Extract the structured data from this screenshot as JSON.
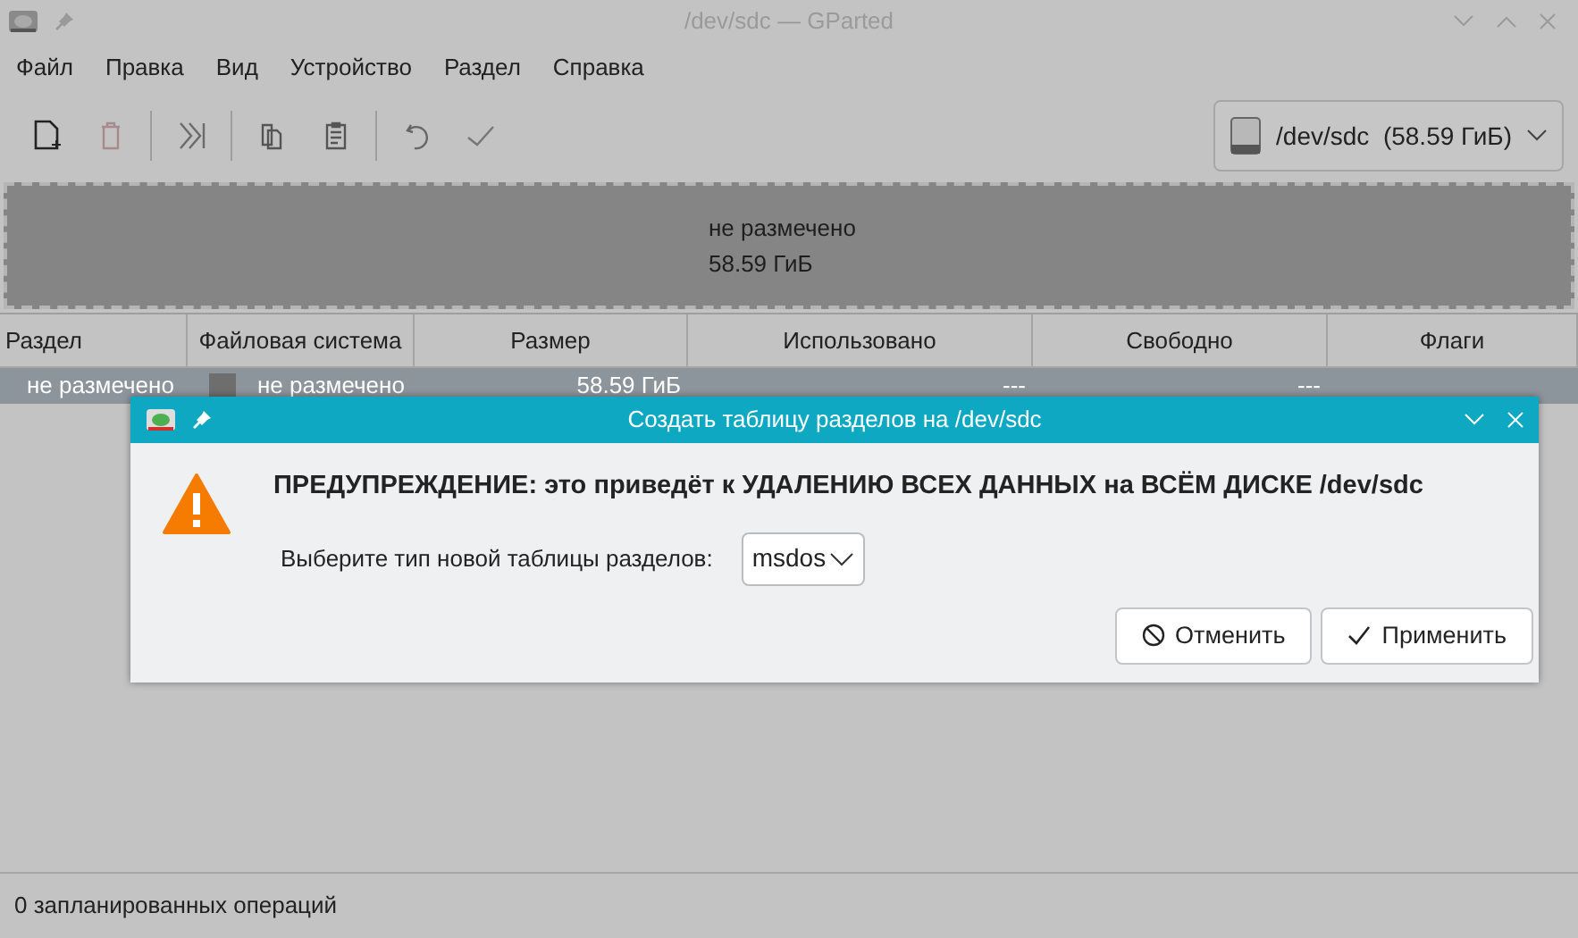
{
  "window": {
    "title": "/dev/sdc — GParted"
  },
  "menu": [
    "Файл",
    "Правка",
    "Вид",
    "Устройство",
    "Раздел",
    "Справка"
  ],
  "device_selector": {
    "value": "/dev/sdc  (58.59 ГиБ)"
  },
  "disk_map": {
    "label": "не размечено",
    "size": "58.59 ГиБ"
  },
  "table": {
    "columns": [
      "Раздел",
      "Файловая система",
      "Размер",
      "Использовано",
      "Свободно",
      "Флаги"
    ],
    "rows": [
      {
        "partition": "не размечено",
        "color": "#6e6e6e",
        "filesystem": "не размечено",
        "size": "58.59 ГиБ",
        "used": "---",
        "free": "---",
        "selected": true
      }
    ]
  },
  "dialog": {
    "title": "Создать таблицу разделов на /dev/sdc",
    "warning": "ПРЕДУПРЕЖДЕНИЕ: это приведёт к УДАЛЕНИЮ ВСЕХ ДАННЫХ на ВСЁМ ДИСКЕ /dev/sdc",
    "label": "Выберите тип новой таблицы разделов:",
    "table_type": "msdos",
    "buttons": [
      {
        "kind": "cancel",
        "label": "Отменить"
      },
      {
        "kind": "apply",
        "label": "Применить"
      }
    ]
  },
  "status_bar": "0 запланированных операций"
}
